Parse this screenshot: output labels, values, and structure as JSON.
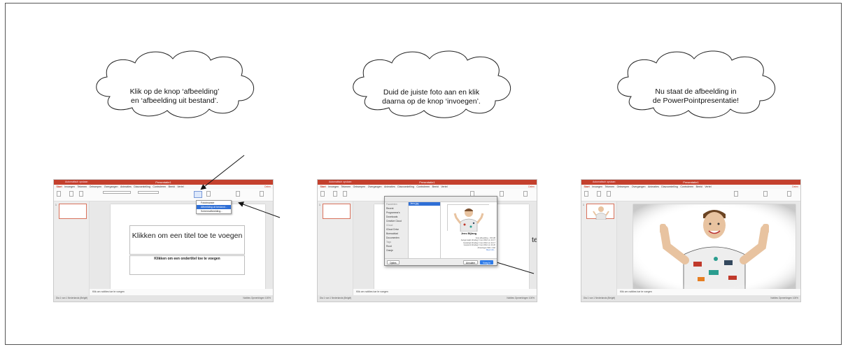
{
  "captions": [
    {
      "line1": "Klik op de knop ‘afbeelding’",
      "line2": "en ‘afbeelding uit bestand’."
    },
    {
      "line1": "Duid de juiste foto aan en klik",
      "line2": "daarna op de knop ‘invoegen’."
    },
    {
      "line1": "Nu staat de afbeelding in",
      "line2": "de PowerPointpresentatie!"
    }
  ],
  "ppt": {
    "window_title": "Presentatie1",
    "autosave": "Automatisch opslaan",
    "tabs": [
      "Start",
      "Invoegen",
      "Tekenen",
      "Ontwerpen",
      "Overgangen",
      "Animaties",
      "Diavoorstelling",
      "Controleren",
      "Beeld",
      "Vertel"
    ],
    "share": "Delen",
    "comments": "Opmerkingen",
    "slide_num": "1",
    "notes": "Klik om notities toe te voegen",
    "status_left": "Dia 1 van 1   Nederlands (België)",
    "status_right": "Notities   Opmerkingen   100%"
  },
  "slide1": {
    "title_placeholder": "Klikken om een titel toe te voegen",
    "subtitle_placeholder": "Klikken om een ondertitel toe te voegen",
    "menu": [
      "Fotobrowser",
      "Afbeelding uit bestand...",
      "Schermafbeelding..."
    ]
  },
  "slide2": {
    "behind_text": "te",
    "sidebar": [
      "Favorieten",
      "Recent",
      "Programma's",
      "Downloads",
      "Creative Cloud",
      "iCloud",
      "iCloud Drive",
      "Bureaublad",
      "Documenten",
      "Tags",
      "Rood",
      "Oranje"
    ],
    "selected_file": "Jens.jpg",
    "preview_name": "Jens Bijlang",
    "preview_meta": [
      "Foto afbeelding - 154 kB",
      "Aangemaakt  dinsdag 3 mei 2022 om 11:17",
      "Gewijzigd  dinsdag 3 mei 2022 om 11:17",
      "Geopend  dinsdag 3 mei 2022 om 11:20",
      "Afmetingen  500 × 332",
      "Meer info..."
    ],
    "options_button": "Opties",
    "cancel_button": "Annuleer",
    "insert_button": "Voeg in"
  }
}
